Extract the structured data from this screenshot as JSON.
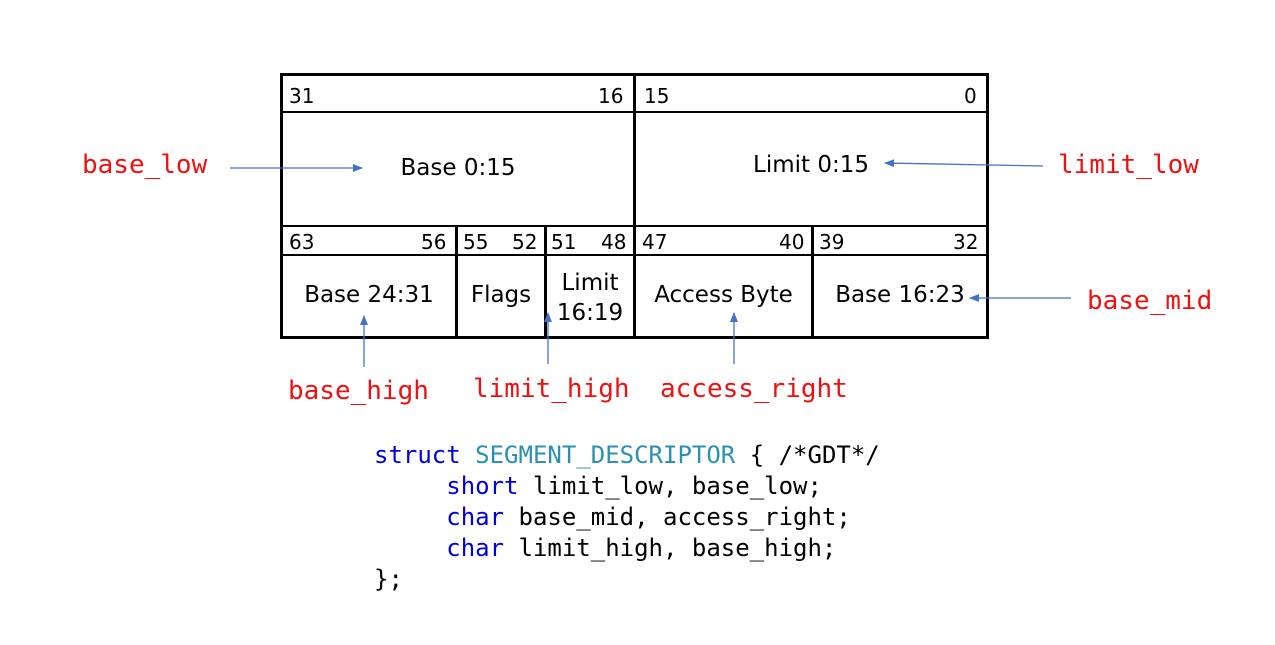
{
  "register_table": {
    "top_row": {
      "left_bits": {
        "high": "31",
        "low": "16"
      },
      "right_bits": {
        "high": "15",
        "low": "0"
      },
      "left_field": "Base 0:15",
      "right_field": "Limit 0:15"
    },
    "bottom_row": [
      {
        "high": "63",
        "low": "56",
        "label": "Base 24:31"
      },
      {
        "high": "55",
        "low": "52",
        "label": "Flags"
      },
      {
        "high": "51",
        "low": "48",
        "label": "Limit\n16:19"
      },
      {
        "high": "47",
        "low": "40",
        "label": "Access Byte"
      },
      {
        "high": "39",
        "low": "32",
        "label": "Base 16:23"
      }
    ]
  },
  "annotations": {
    "base_low": "base_low",
    "limit_low": "limit_low",
    "base_mid": "base_mid",
    "base_high": "base_high",
    "limit_high": "limit_high",
    "access_right": "access_right"
  },
  "code": {
    "line1_keyword": "struct",
    "line1_type": "SEGMENT_DESCRIPTOR",
    "line1_rest": " { /*GDT*/",
    "line2_keyword": "short",
    "line2_rest": " limit_low, base_low;",
    "line3_keyword": "char",
    "line3_rest": " base_mid, access_right;",
    "line4_keyword": "char",
    "line4_rest": " limit_high, base_high;",
    "line5": "};"
  },
  "colors": {
    "annotation": "#ee1111",
    "arrow": "#4472c4",
    "keyword": "#0000dd",
    "type_name": "#2b91af"
  }
}
